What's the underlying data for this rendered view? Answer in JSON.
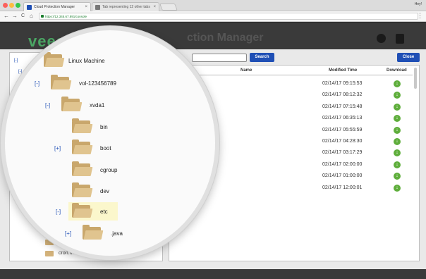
{
  "browser": {
    "tabs": [
      {
        "label": "Cloud Protection Manager",
        "close": "×"
      },
      {
        "label": "Tab representing 12 other tabs",
        "close": "×"
      }
    ],
    "user": "Hey!",
    "nav": {
      "back": "←",
      "forward": "→",
      "reload": "C",
      "home": "⌂"
    },
    "url": "https://12.345.67.891/console",
    "menu": "⋮"
  },
  "app": {
    "logo": "veeam",
    "title": "ction Manager",
    "search_button": "Search",
    "close_button": "Close"
  },
  "columns": {
    "name": "Name",
    "modified": "Modified Time",
    "download": "Download"
  },
  "rows": [
    {
      "modified": "02/14/17 09:15:53"
    },
    {
      "modified": "02/14/17 08:12:32"
    },
    {
      "modified": "02/14/17 07:15:48"
    },
    {
      "modified": "02/14/17 06:35:13"
    },
    {
      "modified": "02/14/17 05:55:59"
    },
    {
      "modified": "02/14/17 04:28:30"
    },
    {
      "modified": "02/14/17 03:17:29"
    },
    {
      "modified": "02/14/17 02:00:00"
    },
    {
      "modified": "02/14/17 01:00:00"
    },
    {
      "modified": "02/14/17 12:00:01"
    }
  ],
  "tree_small": {
    "root_toggle": "[-]",
    "child_toggle": "[-]",
    "cron_label": "cron.mo..."
  },
  "magnifier": {
    "items": [
      {
        "toggle": "",
        "label": "Linux Machine"
      },
      {
        "toggle": "[-]",
        "label": "vol-123456789"
      },
      {
        "toggle": "[-]",
        "label": "xvda1"
      },
      {
        "toggle": "",
        "label": "bin"
      },
      {
        "toggle": "[+]",
        "label": "boot"
      },
      {
        "toggle": "",
        "label": "cgroup"
      },
      {
        "toggle": "",
        "label": "dev"
      },
      {
        "toggle": "[-]",
        "label": "etc"
      },
      {
        "toggle": "[+]",
        "label": ".java"
      }
    ]
  },
  "colors": {
    "accent": "#1f4fb5",
    "folder": "#c9a76c",
    "download": "#5fae3c",
    "highlight": "#fbf7cc"
  }
}
